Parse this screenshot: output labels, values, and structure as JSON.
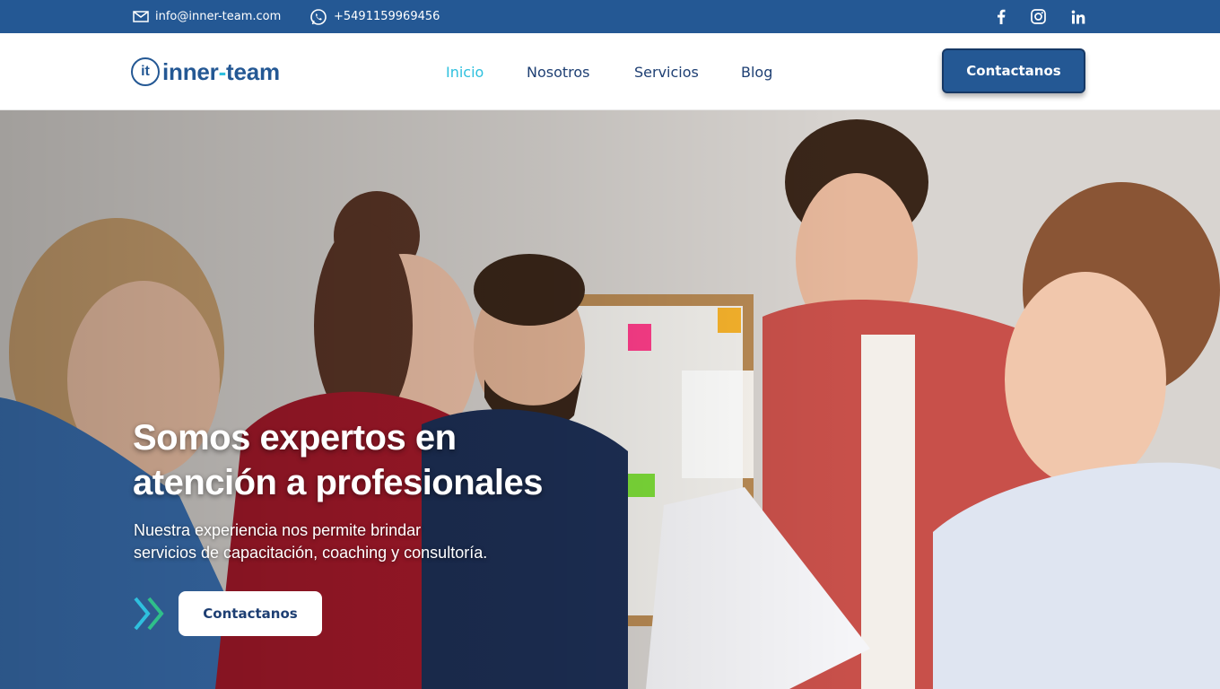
{
  "topbar": {
    "email": "info@inner-team.com",
    "phone": "+5491159969456",
    "icons": [
      "mail-icon",
      "whatsapp-icon",
      "facebook-icon",
      "instagram-icon",
      "linkedin-icon"
    ],
    "background": "#245894"
  },
  "header": {
    "logo_mark": "it",
    "logo_word_1": "inner",
    "logo_dash": "-",
    "logo_word_2": "team",
    "nav": [
      "Inicio",
      "Nosotros",
      "Servicios",
      "Blog"
    ],
    "active_nav": "Inicio",
    "cta": "Contactanos",
    "accent": "#2ec0de",
    "brand": "#245894"
  },
  "hero": {
    "title_line_1": "Somos expertos en",
    "title_line_2": "atención a profesionales",
    "subtitle_line_1": "Nuestra experiencia nos permite brindar",
    "subtitle_line_2": "servicios de capacitación, coaching y consultoría.",
    "cta": "Contactanos",
    "icons": [
      "double-chevron-icon"
    ]
  }
}
